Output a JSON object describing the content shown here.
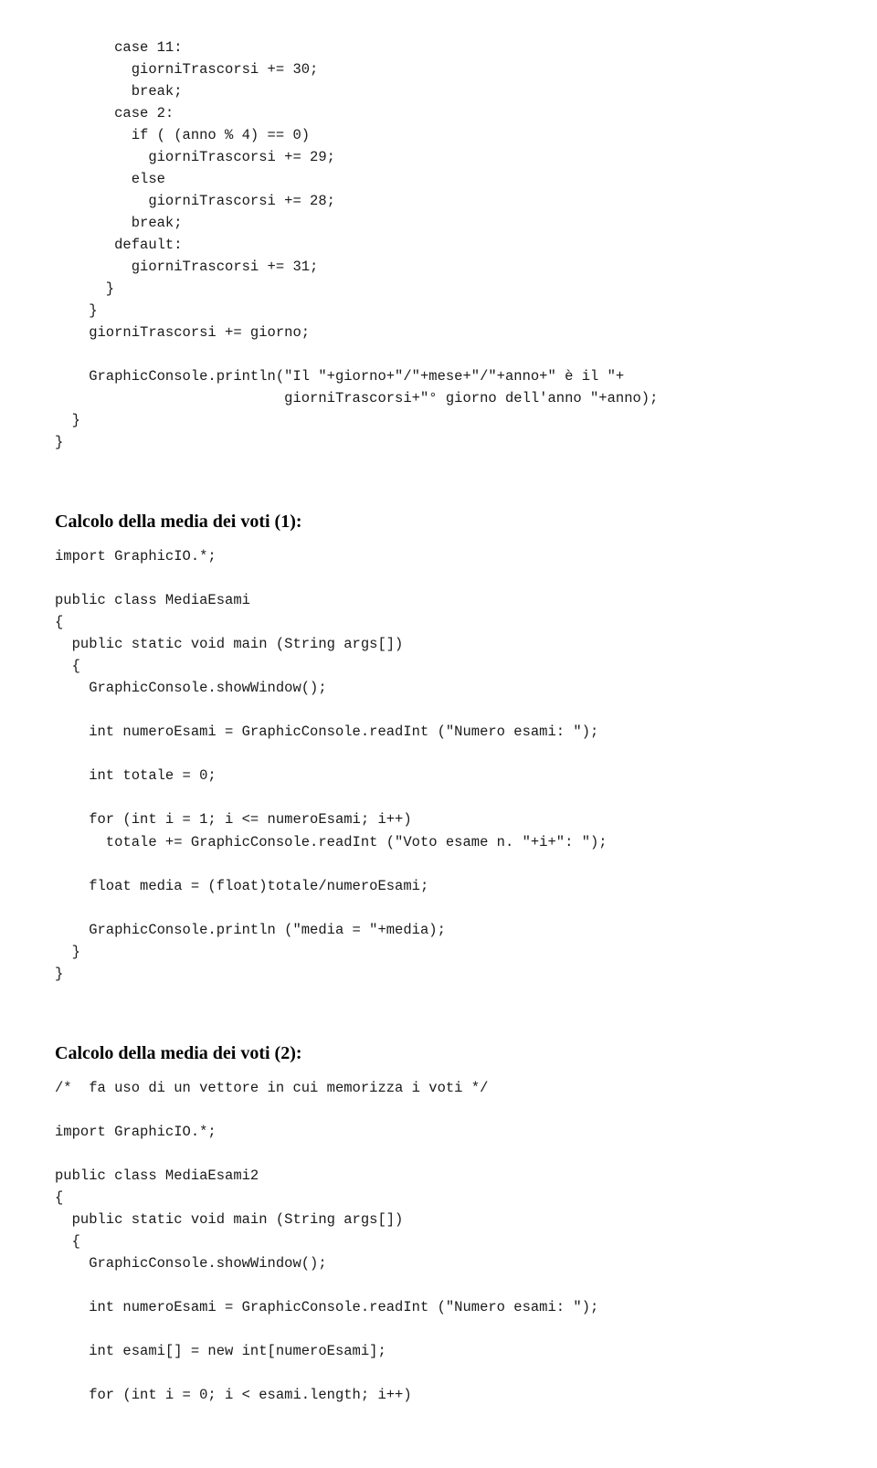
{
  "block1": "       case 11:\n         giorniTrascorsi += 30;\n         break;\n       case 2:\n         if ( (anno % 4) == 0)\n           giorniTrascorsi += 29;\n         else\n           giorniTrascorsi += 28;\n         break;\n       default:\n         giorniTrascorsi += 31;\n      }\n    }\n    giorniTrascorsi += giorno;\n\n    GraphicConsole.println(\"Il \"+giorno+\"/\"+mese+\"/\"+anno+\" è il \"+\n                           giorniTrascorsi+\"° giorno dell'anno \"+anno);\n  }\n}",
  "heading1": "Calcolo della media dei voti (1):",
  "block2": "import GraphicIO.*;\n\npublic class MediaEsami\n{\n  public static void main (String args[])\n  {\n    GraphicConsole.showWindow();\n\n    int numeroEsami = GraphicConsole.readInt (\"Numero esami: \");\n\n    int totale = 0;\n\n    for (int i = 1; i <= numeroEsami; i++)\n      totale += GraphicConsole.readInt (\"Voto esame n. \"+i+\": \");\n\n    float media = (float)totale/numeroEsami;\n\n    GraphicConsole.println (\"media = \"+media);\n  }\n}",
  "heading2": "Calcolo della media dei voti (2):",
  "block3": "/*  fa uso di un vettore in cui memorizza i voti */\n\nimport GraphicIO.*;\n\npublic class MediaEsami2\n{\n  public static void main (String args[])\n  {\n    GraphicConsole.showWindow();\n\n    int numeroEsami = GraphicConsole.readInt (\"Numero esami: \");\n\n    int esami[] = new int[numeroEsami];\n\n    for (int i = 0; i < esami.length; i++)"
}
